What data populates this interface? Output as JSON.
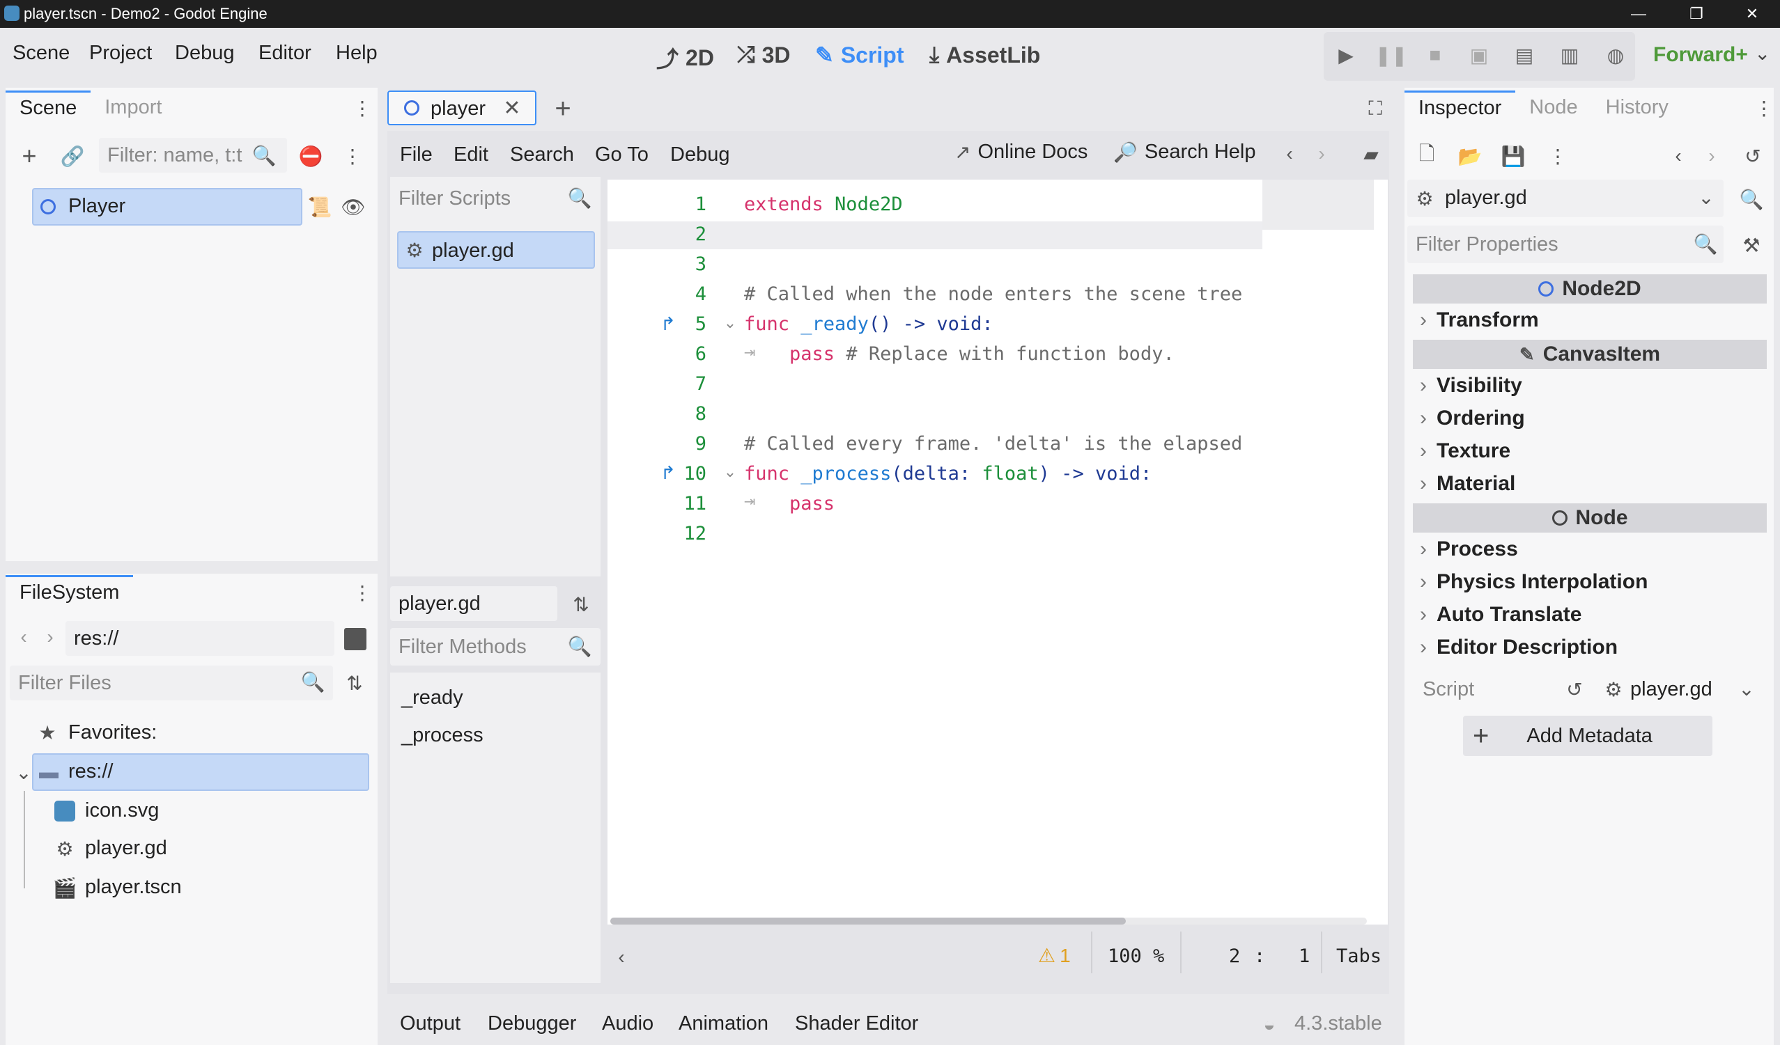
{
  "window": {
    "title": "player.tscn - Demo2 - Godot Engine"
  },
  "menu": [
    "Scene",
    "Project",
    "Debug",
    "Editor",
    "Help"
  ],
  "workspaces": [
    {
      "label": "2D",
      "icon": "2d-icon"
    },
    {
      "label": "3D",
      "icon": "3d-icon"
    },
    {
      "label": "Script",
      "icon": "script-icon"
    },
    {
      "label": "AssetLib",
      "icon": "assetlib-icon"
    }
  ],
  "active_workspace": "Script",
  "renderer": "Forward+",
  "scene_dock": {
    "tabs": [
      "Scene",
      "Import"
    ],
    "filter_placeholder": "Filter: name, t:t",
    "root_node": "Player"
  },
  "filesystem": {
    "tab": "FileSystem",
    "path": "res://",
    "filter_placeholder": "Filter Files",
    "favorites_label": "Favorites:",
    "items": [
      {
        "name": "res://",
        "icon": "folder-icon"
      },
      {
        "name": "icon.svg",
        "icon": "godot-icon"
      },
      {
        "name": "player.gd",
        "icon": "gear-icon"
      },
      {
        "name": "player.tscn",
        "icon": "clapper-icon"
      }
    ]
  },
  "scene_tabs": {
    "active": "player"
  },
  "script_menu": [
    "File",
    "Edit",
    "Search",
    "Go To",
    "Debug"
  ],
  "script_toolbar": {
    "online_docs": "Online Docs",
    "search_help": "Search Help"
  },
  "scripts_panel": {
    "filter_placeholder": "Filter Scripts",
    "items": [
      "player.gd"
    ],
    "current": "player.gd",
    "methods_filter_placeholder": "Filter Methods",
    "methods": [
      "_ready",
      "_process"
    ]
  },
  "code": {
    "lines": [
      {
        "n": "1",
        "tokens": [
          {
            "t": "extends",
            "c": "kw"
          },
          {
            "t": " Node2D",
            "c": "type"
          }
        ]
      },
      {
        "n": "2",
        "tokens": []
      },
      {
        "n": "3",
        "tokens": []
      },
      {
        "n": "4",
        "tokens": [
          {
            "t": "# Called when the node enters the scene tree",
            "c": "cm"
          }
        ]
      },
      {
        "n": "5",
        "tokens": [
          {
            "t": "func",
            "c": "kw"
          },
          {
            "t": " _ready",
            "c": "fn"
          },
          {
            "t": "() -> ",
            "c": "pl"
          },
          {
            "t": "void",
            "c": "kw2"
          },
          {
            "t": ":",
            "c": "pl"
          }
        ]
      },
      {
        "n": "6",
        "tokens": [
          {
            "t": "    pass",
            "c": "kw"
          },
          {
            "t": " # Replace with function body.",
            "c": "cm"
          }
        ]
      },
      {
        "n": "7",
        "tokens": []
      },
      {
        "n": "8",
        "tokens": []
      },
      {
        "n": "9",
        "tokens": [
          {
            "t": "# Called every frame. 'delta' is the elapsed",
            "c": "cm"
          }
        ]
      },
      {
        "n": "10",
        "tokens": [
          {
            "t": "func",
            "c": "kw"
          },
          {
            "t": " _process",
            "c": "fn"
          },
          {
            "t": "(delta: ",
            "c": "pl"
          },
          {
            "t": "float",
            "c": "type"
          },
          {
            "t": ") -> ",
            "c": "pl"
          },
          {
            "t": "void",
            "c": "kw2"
          },
          {
            "t": ":",
            "c": "pl"
          }
        ]
      },
      {
        "n": "11",
        "tokens": [
          {
            "t": "    pass",
            "c": "kw"
          }
        ]
      },
      {
        "n": "12",
        "tokens": []
      }
    ],
    "colors": {
      "kw": "#d6336c",
      "kw2": "#1f3a93",
      "type": "#1c8f3a",
      "fn": "#1f7bd1",
      "cm": "#6b6b6b",
      "pl": "#1f3a93"
    }
  },
  "status": {
    "warnings": "1",
    "zoom": "100 %",
    "line": "2",
    "col": "1",
    "indent": "Tabs"
  },
  "bottom_panel": {
    "tabs": [
      "Output",
      "Debugger",
      "Audio",
      "Animation",
      "Shader Editor"
    ],
    "version": "4.3.stable"
  },
  "inspector": {
    "tabs": [
      "Inspector",
      "Node",
      "History"
    ],
    "object": "player.gd",
    "filter_placeholder": "Filter Properties",
    "sections": [
      {
        "type": "header",
        "label": "Node2D",
        "icon": "circle-icon"
      },
      {
        "type": "prop",
        "label": "Transform"
      },
      {
        "type": "header",
        "label": "CanvasItem",
        "icon": "pencil-icon"
      },
      {
        "type": "prop",
        "label": "Visibility"
      },
      {
        "type": "prop",
        "label": "Ordering"
      },
      {
        "type": "prop",
        "label": "Texture"
      },
      {
        "type": "prop",
        "label": "Material"
      },
      {
        "type": "header",
        "label": "Node",
        "icon": "circle-icon"
      },
      {
        "type": "prop",
        "label": "Process"
      },
      {
        "type": "prop",
        "label": "Physics Interpolation"
      },
      {
        "type": "prop",
        "label": "Auto Translate"
      },
      {
        "type": "prop",
        "label": "Editor Description"
      }
    ],
    "script_label": "Script",
    "script_value": "player.gd",
    "add_metadata": "Add Metadata"
  },
  "accent": "#3d8ef7"
}
